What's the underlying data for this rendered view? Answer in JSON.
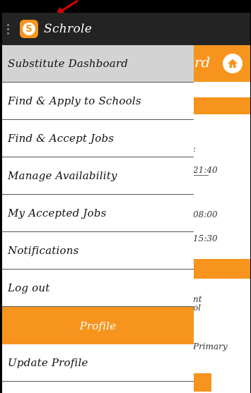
{
  "app": {
    "title": "Schrole",
    "logo_letter": "S",
    "accent_color": "#f7941d"
  },
  "background": {
    "header_text": "rd",
    "texts": [
      ":",
      "21:40",
      "08:00",
      "15:30",
      "nt",
      "ol",
      "Primary"
    ]
  },
  "drawer": {
    "items": [
      {
        "label": "Substitute Dashboard",
        "active": true
      },
      {
        "label": "Find & Apply to Schools"
      },
      {
        "label": "Find & Accept Jobs"
      },
      {
        "label": "Manage Availability"
      },
      {
        "label": "My Accepted Jobs"
      },
      {
        "label": "Notifications"
      },
      {
        "label": "Log out"
      }
    ],
    "section": "Profile",
    "profile_items": [
      {
        "label": "Update Profile"
      }
    ]
  }
}
